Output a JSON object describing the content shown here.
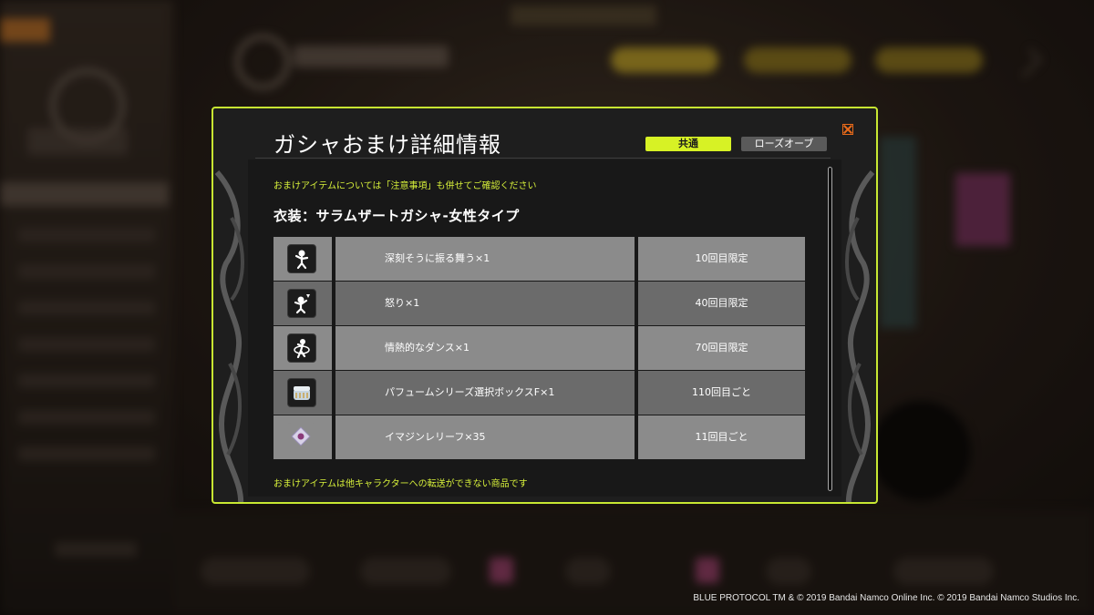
{
  "dialog": {
    "title": "ガシャおまけ詳細情報",
    "tabs": [
      {
        "label": "共通",
        "active": true
      },
      {
        "label": "ローズオーブ",
        "active": false
      }
    ],
    "notice": "おまけアイテムについては「注意事項」も併せてご確認ください",
    "section_title": "衣装：サラムザートガシャ-女性タイプ",
    "items": [
      {
        "icon": "gesture-figure-icon",
        "name": "深刻そうに振る舞う×1",
        "condition": "10回目限定"
      },
      {
        "icon": "angry-figure-icon",
        "name": "怒り×1",
        "condition": "40回目限定"
      },
      {
        "icon": "dance-figure-icon",
        "name": "情熱的なダンス×1",
        "condition": "70回目限定"
      },
      {
        "icon": "perfume-box-icon",
        "name": "パフュームシリーズ選択ボックスF×1",
        "condition": "110回目ごと"
      },
      {
        "icon": "imagine-relief-icon",
        "name": "イマジンレリーフ×35",
        "condition": "11回目ごと"
      }
    ],
    "footer_note": "おまけアイテムは他キャラクターへの転送ができない商品です"
  },
  "copyright": "BLUE PROTOCOL TM & © 2019 Bandai Namco Online Inc.  © 2019 Bandai Namco Studios Inc.",
  "colors": {
    "accent": "#d7f225",
    "border": "#c8e832",
    "close": "#e86a1a"
  }
}
